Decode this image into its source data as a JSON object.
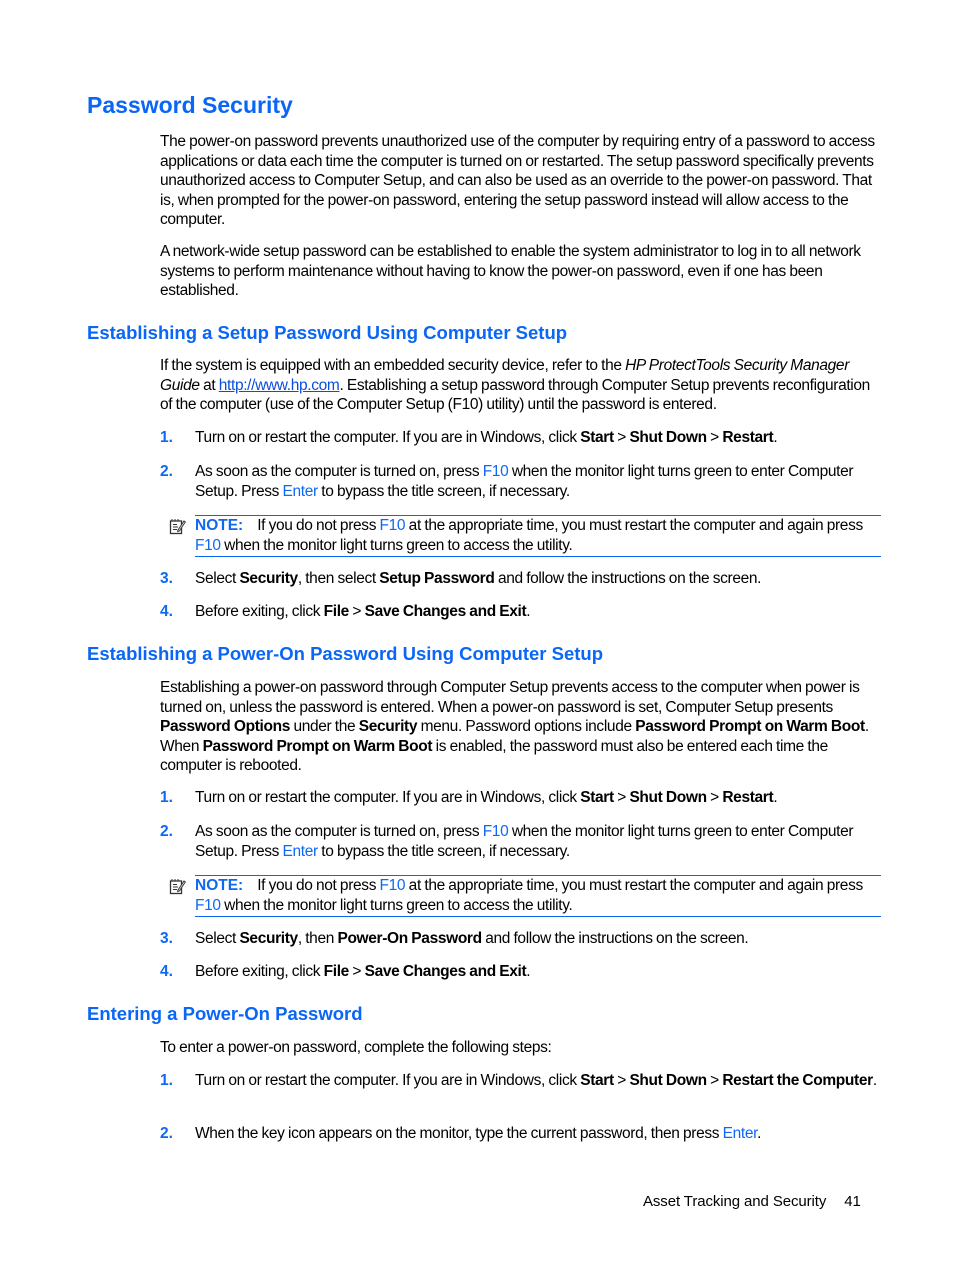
{
  "title": "Password Security",
  "intro": {
    "p1": "The power-on password prevents unauthorized use of the computer by requiring entry of a password to access applications or data each time the computer is turned on or restarted. The setup password specifically prevents unauthorized access to Computer Setup, and can also be used as an override to the power-on password. That is, when prompted for the power-on password, entering the setup password instead will allow access to the computer.",
    "p2": "A network-wide setup password can be established to enable the system administrator to log in to all network systems to perform maintenance without having to know the power-on password, even if one has been established."
  },
  "section1": {
    "heading": "Establishing a Setup Password Using Computer Setup",
    "para": {
      "a": "If the system is equipped with an embedded security device, refer to the ",
      "italic": "HP ProtectTools Security Manager Guide",
      "b": " at ",
      "link": "http://www.hp.com",
      "c": ". Establishing a setup password through Computer Setup prevents reconfiguration of the computer (use of the Computer Setup (F10) utility) until the password is entered."
    },
    "steps": [
      {
        "num": "1.",
        "a": "Turn on or restart the computer. If you are in Windows, click ",
        "b1": "Start",
        "s1": " > ",
        "b2": "Shut Down",
        "s2": " > ",
        "b3": "Restart",
        "end": "."
      },
      {
        "num": "2.",
        "a": "As soon as the computer is turned on, press ",
        "k1": "F10",
        "b": " when the monitor light turns green to enter Computer Setup. Press ",
        "k2": "Enter",
        "c": " to bypass the title screen, if necessary."
      },
      {
        "num": "3.",
        "a": "Select ",
        "b1": "Security",
        "m": ", then select ",
        "b2": "Setup Password",
        "end": " and follow the instructions on the screen."
      },
      {
        "num": "4.",
        "a": "Before exiting, click ",
        "b1": "File",
        "s1": " > ",
        "b2": "Save Changes and Exit",
        "end": "."
      }
    ],
    "note": {
      "label": "NOTE:",
      "a": "If you do not press ",
      "k1": "F10",
      "b": " at the appropriate time, you must restart the computer and again press ",
      "k2": "F10",
      "c": " when the monitor light turns green to access the utility."
    }
  },
  "section2": {
    "heading": "Establishing a Power-On Password Using Computer Setup",
    "para": {
      "a": "Establishing a power-on password through Computer Setup prevents access to the computer when power is turned on, unless the password is entered. When a power-on password is set, Computer Setup presents ",
      "b1": "Password Options",
      "m1": " under the ",
      "b2": "Security",
      "m2": " menu. Password options include ",
      "b3": "Password Prompt on Warm Boot",
      "m3": ". When ",
      "b4": "Password Prompt on Warm Boot",
      "end": " is enabled, the password must also be entered each time the computer is rebooted."
    },
    "steps": [
      {
        "num": "1.",
        "a": "Turn on or restart the computer. If you are in Windows, click ",
        "b1": "Start",
        "s1": " > ",
        "b2": "Shut Down",
        "s2": " > ",
        "b3": "Restart",
        "end": "."
      },
      {
        "num": "2.",
        "a": "As soon as the computer is turned on, press ",
        "k1": "F10",
        "b": " when the monitor light turns green to enter Computer Setup. Press ",
        "k2": "Enter",
        "c": " to bypass the title screen, if necessary."
      },
      {
        "num": "3.",
        "a": "Select ",
        "b1": "Security",
        "m": ", then ",
        "b2": "Power-On Password",
        "end": " and follow the instructions on the screen."
      },
      {
        "num": "4.",
        "a": "Before exiting, click ",
        "b1": "File",
        "s1": " > ",
        "b2": "Save Changes and Exit",
        "end": "."
      }
    ],
    "note": {
      "label": "NOTE:",
      "a": "If you do not press ",
      "k1": "F10",
      "b": " at the appropriate time, you must restart the computer and again press ",
      "k2": "F10",
      "c": " when the monitor light turns green to access the utility."
    }
  },
  "section3": {
    "heading": "Entering a Power-On Password",
    "para": "To enter a power-on password, complete the following steps:",
    "steps": [
      {
        "num": "1.",
        "a": "Turn on or restart the computer. If you are in Windows, click ",
        "b1": "Start",
        "s1": " > ",
        "b2": "Shut Down",
        "s2": " > ",
        "b3": "Restart the Computer",
        "end": "."
      },
      {
        "num": "2.",
        "a": "When the key icon appears on the monitor, type the current password, then press ",
        "k1": "Enter",
        "end": "."
      }
    ]
  },
  "footer": {
    "section": "Asset Tracking and Security",
    "page": "41"
  }
}
